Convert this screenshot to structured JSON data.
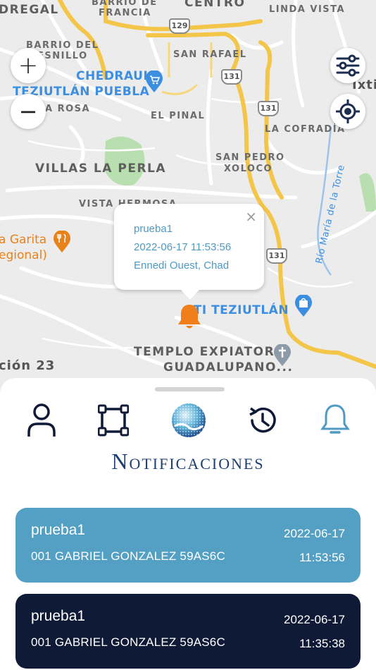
{
  "map": {
    "labels": {
      "dregal": "DREGAL",
      "barrio_de_francia_1": "BARRIO DE",
      "barrio_de_francia_2": "FRANCIA",
      "centro": "CENTRO",
      "linda_vista": "LINDA VISTA",
      "barrio_del_1": "BARRIO DEL",
      "barrio_del_2": "ESNILLO",
      "san_rafael": "SAN RAFAEL",
      "chedraui_1": "CHEDRAUI",
      "chedraui_2": "TEZIUTLÁN PUEBLA",
      "rosa": "A ROSA",
      "el_pinal": "EL PINAL",
      "ixtic": "Ixtic",
      "la_cofradia": "LA COFRADÍA",
      "villas_la_perla": "VILLAS LA PERLA",
      "san_pedro_1": "SAN PEDRO",
      "san_pedro_2": "XOLOCO",
      "rio_maria": "Río María de la Torre",
      "vista_hermosa": "VISTA HERMOSA",
      "la_garita_1": "a Garita",
      "la_garita_2": "egional)",
      "sti_teziutlan": "STI TEZIUTLÁN",
      "templo_1": "TEMPLO EXPIATORIO",
      "templo_2": "GUADALUPANO...",
      "seccion": "ción 23"
    },
    "shields": {
      "r129": "129",
      "r131a": "131",
      "r131b": "131",
      "r131c": "131"
    },
    "controls": {
      "zoom_in": "+",
      "zoom_out": "−",
      "filters_icon": "sliders-icon",
      "locate_icon": "crosshair-icon"
    },
    "popup": {
      "title": "prueba1",
      "datetime": "2022-06-17 11:53:56",
      "location": "Ennedi Ouest, Chad",
      "close": "×"
    },
    "marker_icon": "bell-icon",
    "colors": {
      "marker": "#f07e1b",
      "highway": "#f3c64a",
      "park": "#b9dfb0"
    }
  },
  "sheet": {
    "nav": [
      {
        "icon": "user-icon"
      },
      {
        "icon": "square-frame-icon"
      },
      {
        "icon": "globe-logo-icon"
      },
      {
        "icon": "history-icon"
      },
      {
        "icon": "bell-icon",
        "active": true
      }
    ],
    "title": "Notificaciones",
    "notifications": [
      {
        "name": "prueba1",
        "device": "001 GABRIEL GONZALEZ 59AS6C",
        "date": "2022-06-17",
        "time": "11:53:56",
        "color": "#54a0c4"
      },
      {
        "name": "prueba1",
        "device": "001 GABRIEL GONZALEZ 59AS6C",
        "date": "2022-06-17",
        "time": "11:35:38",
        "color": "#0f1a37"
      }
    ]
  }
}
